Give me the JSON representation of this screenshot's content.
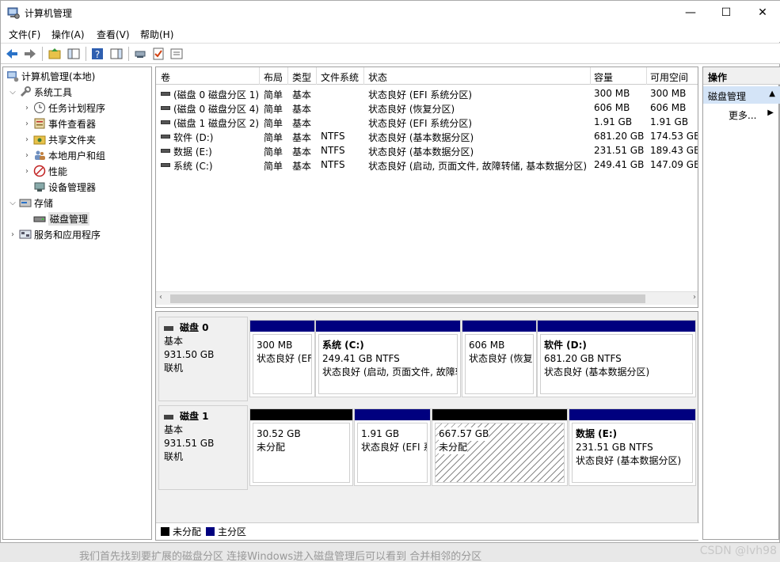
{
  "window": {
    "title": "计算机管理",
    "buttons": {
      "minimize": "—",
      "maximize": "☐",
      "close": "✕"
    }
  },
  "menu": [
    "文件(F)",
    "操作(A)",
    "查看(V)",
    "帮助(H)"
  ],
  "tree": {
    "root": "计算机管理(本地)",
    "system_tools": "系统工具",
    "task_scheduler": "任务计划程序",
    "event_viewer": "事件查看器",
    "shared_folders": "共享文件夹",
    "local_users": "本地用户和组",
    "performance": "性能",
    "device_manager": "设备管理器",
    "storage": "存储",
    "disk_management": "磁盘管理",
    "services_apps": "服务和应用程序"
  },
  "volume_list": {
    "headers": [
      "卷",
      "布局",
      "类型",
      "文件系统",
      "状态",
      "容量",
      "可用空间"
    ],
    "rows": [
      [
        "(磁盘 0 磁盘分区 1)",
        "简单",
        "基本",
        "",
        "状态良好 (EFI 系统分区)",
        "300 MB",
        "300 MB"
      ],
      [
        "(磁盘 0 磁盘分区 4)",
        "简单",
        "基本",
        "",
        "状态良好 (恢复分区)",
        "606 MB",
        "606 MB"
      ],
      [
        "(磁盘 1 磁盘分区 2)",
        "简单",
        "基本",
        "",
        "状态良好 (EFI 系统分区)",
        "1.91 GB",
        "1.91 GB"
      ],
      [
        "软件 (D:)",
        "简单",
        "基本",
        "NTFS",
        "状态良好 (基本数据分区)",
        "681.20 GB",
        "174.53 GB"
      ],
      [
        "数据 (E:)",
        "简单",
        "基本",
        "NTFS",
        "状态良好 (基本数据分区)",
        "231.51 GB",
        "189.43 GB"
      ],
      [
        "系统 (C:)",
        "简单",
        "基本",
        "NTFS",
        "状态良好 (启动, 页面文件, 故障转储, 基本数据分区)",
        "249.41 GB",
        "147.09 GB"
      ]
    ]
  },
  "disks": {
    "disk0": {
      "name": "磁盘 0",
      "type": "基本",
      "size": "931.50 GB",
      "state": "联机",
      "parts": [
        {
          "title": "",
          "line1": "300 MB",
          "line2": "状态良好 (EFI 系统分区)"
        },
        {
          "title": "系统  (C:)",
          "line1": "249.41 GB NTFS",
          "line2": "状态良好 (启动, 页面文件, 故障转储"
        },
        {
          "title": "",
          "line1": "606 MB",
          "line2": "状态良好 (恢复分区)"
        },
        {
          "title": "软件  (D:)",
          "line1": "681.20 GB NTFS",
          "line2": "状态良好 (基本数据分区)"
        }
      ]
    },
    "disk1": {
      "name": "磁盘 1",
      "type": "基本",
      "size": "931.51 GB",
      "state": "联机",
      "parts": [
        {
          "title": "",
          "line1": "30.52 GB",
          "line2": "未分配"
        },
        {
          "title": "",
          "line1": "1.91 GB",
          "line2": "状态良好 (EFI 系统分区)"
        },
        {
          "title": "",
          "line1": "667.57 GB",
          "line2": "未分配"
        },
        {
          "title": "数据  (E:)",
          "line1": "231.51 GB NTFS",
          "line2": "状态良好 (基本数据分区)"
        }
      ]
    }
  },
  "legend": {
    "unallocated": "未分配",
    "primary": "主分区"
  },
  "actions": {
    "header": "操作",
    "section": "磁盘管理",
    "more": "更多..."
  },
  "colors": {
    "primary": "#00007f",
    "unallocated": "#000000",
    "selection": "#d4e4f7"
  },
  "bottom": {
    "faded_text": "我们首先找到要扩展的磁盘分区    连接Windows进入磁盘管理后可以看到    合并相邻的分区",
    "watermark": "CSDN @lvh98"
  }
}
